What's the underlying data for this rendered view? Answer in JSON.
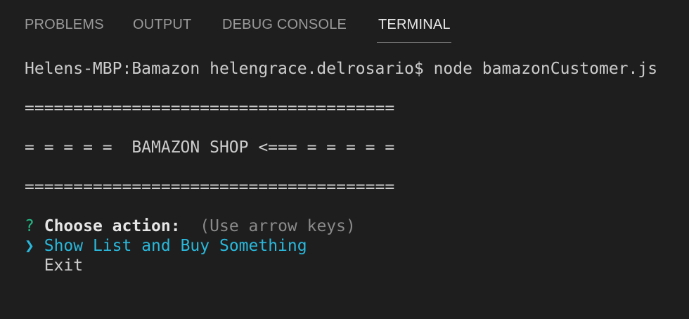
{
  "panel": {
    "tabs": [
      {
        "label": "PROBLEMS",
        "active": false
      },
      {
        "label": "OUTPUT",
        "active": false
      },
      {
        "label": "DEBUG CONSOLE",
        "active": false
      },
      {
        "label": "TERMINAL",
        "active": true
      }
    ]
  },
  "terminal": {
    "command_line": "Helens-MBP:Bamazon helengrace.delrosario$ node bamazonCustomer.js",
    "separator_top": "======================================",
    "banner": "= = = = =  BAMAZON SHOP <=== = = = = =",
    "separator_bottom": "======================================",
    "prompt": {
      "mark": "?",
      "label": "Choose action:",
      "hint": "(Use arrow keys)"
    },
    "options": [
      {
        "pointer": "❯",
        "label": "Show List and Buy Something",
        "selected": true
      },
      {
        "label": "Exit",
        "selected": false
      }
    ]
  },
  "colors": {
    "background": "#1e1e1e",
    "text": "#cccccc",
    "accent_cyan": "#29b8db",
    "prompt_green": "#23b987",
    "tab_inactive": "#9a9a9a",
    "tab_active": "#e7e7e7"
  }
}
